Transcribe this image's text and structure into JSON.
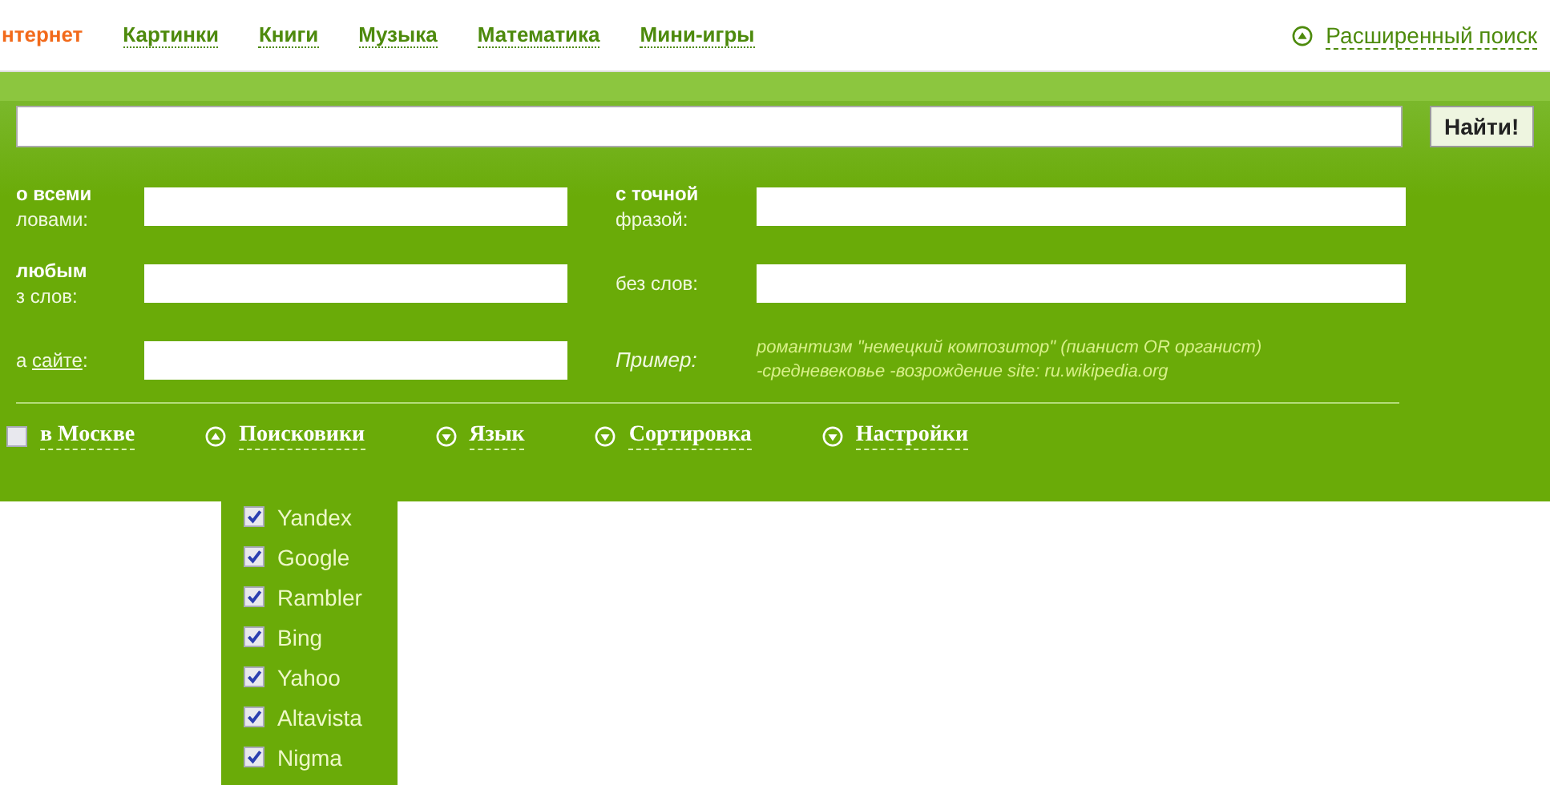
{
  "nav": {
    "tabs": [
      {
        "label": "нтернет",
        "selected": true
      },
      {
        "label": "Картинки",
        "selected": false
      },
      {
        "label": "Книги",
        "selected": false
      },
      {
        "label": "Музыка",
        "selected": false
      },
      {
        "label": "Математика",
        "selected": false
      },
      {
        "label": "Мини-игры",
        "selected": false
      }
    ],
    "advanced": {
      "label": "Расширенный поиск",
      "expanded": true
    }
  },
  "search": {
    "button": "Найти!"
  },
  "fields_left": [
    {
      "kind": "field",
      "label": "**о всеми**\nловами:"
    },
    {
      "kind": "field",
      "label": "**любым**\nз слов:"
    },
    {
      "kind": "site",
      "prefix": "а ",
      "link": "сайте",
      "suffix": ":"
    }
  ],
  "fields_right": [
    {
      "kind": "field",
      "label": "**с точной**\nфразой:"
    },
    {
      "kind": "field",
      "label": "без слов:"
    },
    {
      "kind": "example",
      "label": "Пример:",
      "text": "романтизм \"немецкий композитор\" (пианист OR органист) -средневековье -возрождение site: ru.wikipedia.org"
    }
  ],
  "options": [
    {
      "kind": "checkbox",
      "label": "в Москве",
      "checked": false
    },
    {
      "kind": "toggle",
      "label": "Поисковики",
      "expanded": true
    },
    {
      "kind": "toggle",
      "label": "Язык",
      "expanded": false
    },
    {
      "kind": "toggle",
      "label": "Сортировка",
      "expanded": false
    },
    {
      "kind": "toggle",
      "label": "Настройки",
      "expanded": false
    }
  ],
  "engines": [
    {
      "label": "Yandex",
      "checked": true
    },
    {
      "label": "Google",
      "checked": true
    },
    {
      "label": "Rambler",
      "checked": true
    },
    {
      "label": "Bing",
      "checked": true
    },
    {
      "label": "Yahoo",
      "checked": true
    },
    {
      "label": "Altavista",
      "checked": true
    },
    {
      "label": "Nigma",
      "checked": true
    }
  ]
}
